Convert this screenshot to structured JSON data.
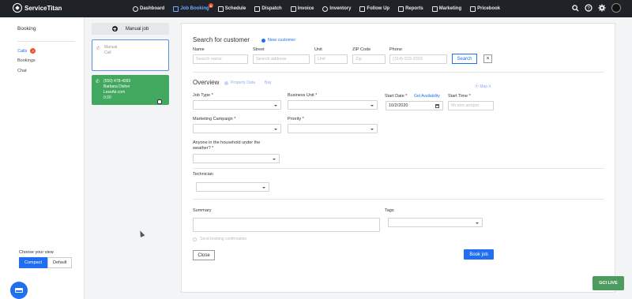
{
  "brand": {
    "name": "ServiceTitan"
  },
  "nav": {
    "items": [
      {
        "label": "Dashboard",
        "icon": "dashboard-icon"
      },
      {
        "label": "Job Booking",
        "icon": "job-booking-icon",
        "active": true,
        "badge": "8"
      },
      {
        "label": "Schedule",
        "icon": "schedule-icon"
      },
      {
        "label": "Dispatch",
        "icon": "dispatch-icon"
      },
      {
        "label": "Invoice",
        "icon": "invoice-icon"
      },
      {
        "label": "Inventory",
        "icon": "inventory-icon"
      },
      {
        "label": "Follow Up",
        "icon": "follow-up-icon"
      },
      {
        "label": "Reports",
        "icon": "reports-icon"
      },
      {
        "label": "Marketing",
        "icon": "marketing-icon"
      },
      {
        "label": "Pricebook",
        "icon": "pricebook-icon"
      }
    ],
    "right_icons": [
      "search-icon",
      "help-icon",
      "gear-icon",
      "user-avatar"
    ]
  },
  "sidebar": {
    "title": "Booking",
    "items": [
      {
        "label": "Calls",
        "badge": "2",
        "active": true
      },
      {
        "label": "Bookings"
      },
      {
        "label": "Chat"
      }
    ],
    "view": {
      "label": "Choose your view",
      "options": [
        "Compact",
        "Default"
      ],
      "selected": "Compact"
    }
  },
  "calls": {
    "manual_job_label": "Manual job",
    "manual_card": {
      "line1": "Manual",
      "line2": "Call"
    },
    "active_call": {
      "phone": "(550) 478-4093",
      "name": "Barbara Disher",
      "source": "LessAir.com",
      "duration": "0:20",
      "color": "#42a85f"
    }
  },
  "search": {
    "title": "Search for customer",
    "new_customer": "New customer",
    "fields": {
      "name": {
        "label": "Name",
        "placeholder": "Search name"
      },
      "street": {
        "label": "Street",
        "placeholder": "Search address"
      },
      "unit": {
        "label": "Unit",
        "placeholder": "Unit"
      },
      "zip": {
        "label": "ZIP Code",
        "placeholder": "Zip"
      },
      "phone": {
        "label": "Phone",
        "placeholder": "(314)-333-3333"
      }
    },
    "search_button": "Search",
    "clear_button": "×"
  },
  "overview": {
    "title": "Overview",
    "property_data": "Property Data",
    "bay": "Bay",
    "map_it": "Map it",
    "job_type_label": "Job Type *",
    "business_unit_label": "Business Unit *",
    "start_date_label": "Start Date *",
    "get_availability": "Get Availability",
    "start_date_value": "10/2/2020",
    "start_time_label": "Start Time *",
    "start_time_placeholder": "hh:mm am/pm",
    "marketing_campaign_label": "Marketing Campaign *",
    "priority_label": "Priority *",
    "household_label_1": "Anyone in the household under the",
    "household_label_2": "weather? *",
    "technician_label": "Technician",
    "summary_label": "Summary",
    "tags_label": "Tags",
    "send_confirmation": "Send booking confirmation",
    "close_button": "Close",
    "book_button": "Book job"
  },
  "gci_live": "GCI LIVE",
  "colors": {
    "accent": "#1f6ff0",
    "nav_bg": "#1f2328",
    "badge": "#e8542c"
  }
}
